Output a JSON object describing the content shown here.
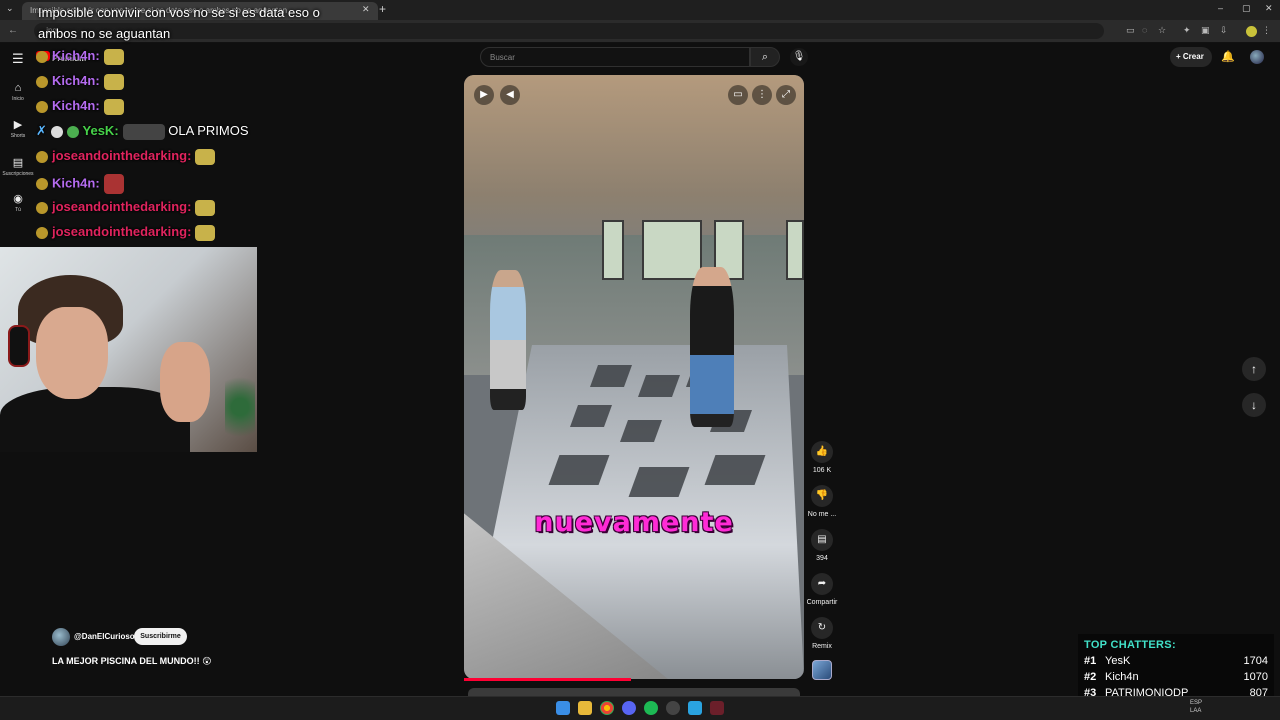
{
  "browser": {
    "tabs": [
      {
        "label": "Imposible convivir con vos no se si es data eso o ambos no se aguantan"
      }
    ],
    "address": ".jpg"
  },
  "overlay": {
    "top_message": "Imposible convivir con vos no se si es data eso o ambos no se aguantan"
  },
  "youtube": {
    "brand": "Premium",
    "search_placeholder": "Buscar",
    "create_label": "Crear",
    "nav": [
      {
        "label": "Inicio",
        "icon": "home-icon"
      },
      {
        "label": "Shorts",
        "icon": "shorts-icon"
      },
      {
        "label": "Suscripciones",
        "icon": "subscriptions-icon"
      },
      {
        "label": "Tú",
        "icon": "you-icon"
      }
    ]
  },
  "chat": [
    {
      "user": "Kich4n",
      "color": "#b56cf0",
      "text": ""
    },
    {
      "user": "Kich4n",
      "color": "#b56cf0",
      "text": ""
    },
    {
      "user": "Kich4n",
      "color": "#b56cf0",
      "text": ""
    },
    {
      "user": "YesK",
      "color": "#47d24a",
      "text": "OLA PRIMOS"
    },
    {
      "user": "joseandointhedarking",
      "color": "#e0245e",
      "text": ""
    },
    {
      "user": "Kich4n",
      "color": "#b56cf0",
      "text": ""
    },
    {
      "user": "joseandointhedarking",
      "color": "#e0245e",
      "text": ""
    },
    {
      "user": "joseandointhedarking",
      "color": "#e0245e",
      "text": ""
    }
  ],
  "video": {
    "caption": "nuevamente",
    "progress": 0.49
  },
  "actions": {
    "like_count": "106 K",
    "dislike_label": "No me ...",
    "comment_count": "394",
    "share_label": "Compartir",
    "remix_label": "Remix"
  },
  "channel": {
    "handle": "@DanElCurioso",
    "subscribe_label": "Suscribirme",
    "title": "LA MEJOR PISCINA DEL MUNDO!! 😲"
  },
  "top_chatters": {
    "header": "TOP CHATTERS:",
    "rows": [
      {
        "rank": "#1",
        "name": "YesK",
        "score": "1704"
      },
      {
        "rank": "#2",
        "name": "Kich4n",
        "score": "1070"
      },
      {
        "rank": "#3",
        "name": "PATRIMONIODP",
        "score": "807"
      }
    ]
  },
  "taskbar": {
    "lang": "ESP",
    "lang2": "LAA"
  }
}
